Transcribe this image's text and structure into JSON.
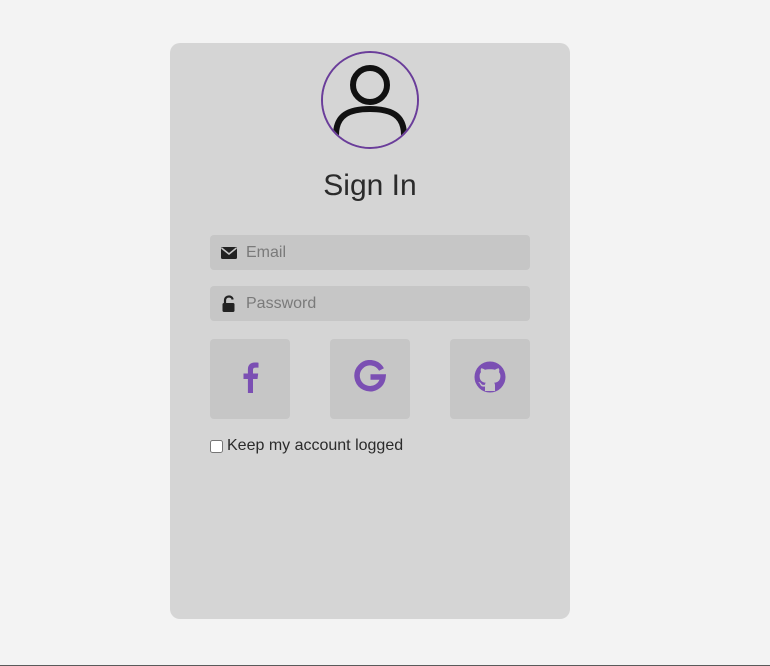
{
  "login": {
    "title": "Sign In",
    "email_placeholder": "Email",
    "password_placeholder": "Password",
    "remember_label": "Keep my account logged",
    "remember_checked": false
  },
  "social": [
    {
      "name": "facebook",
      "icon": "facebook-icon"
    },
    {
      "name": "google",
      "icon": "google-icon"
    },
    {
      "name": "github",
      "icon": "github-icon"
    }
  ],
  "colors": {
    "background": "#f3f3f3",
    "card": "#d5d5d5",
    "field": "#c6c6c6",
    "accent": "#7b4fb3",
    "avatar_border": "#6a3d9a",
    "text": "#2b2b2b"
  }
}
